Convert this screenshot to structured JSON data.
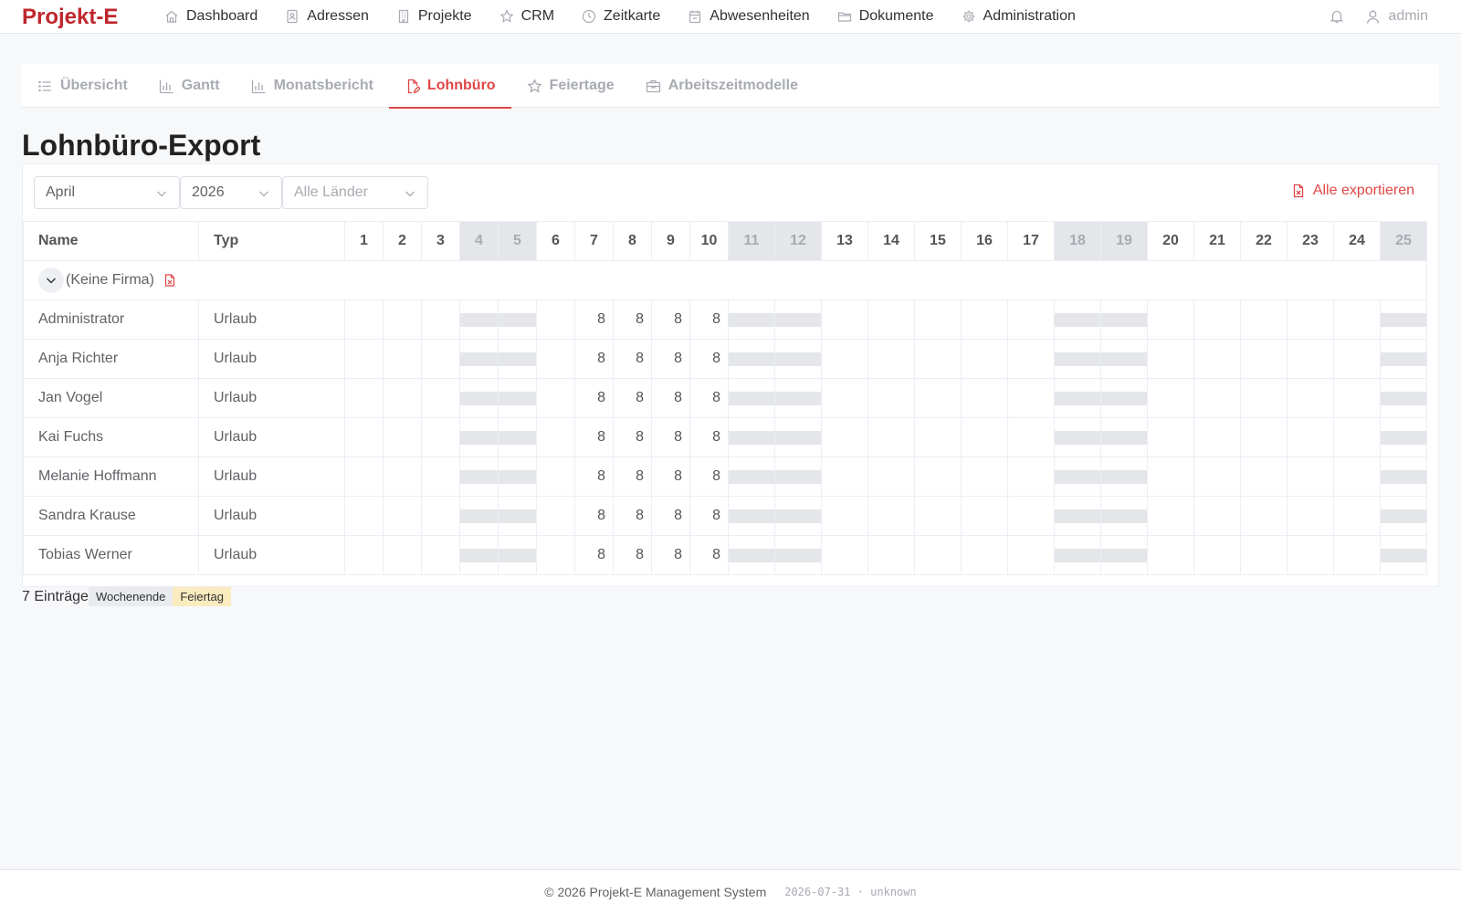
{
  "app": {
    "brand": "Projekt-E",
    "user": "admin"
  },
  "nav": {
    "items": [
      {
        "label": "Dashboard",
        "icon": "home-icon"
      },
      {
        "label": "Adressen",
        "icon": "address-book-icon"
      },
      {
        "label": "Projekte",
        "icon": "building-icon"
      },
      {
        "label": "CRM",
        "icon": "star-icon"
      },
      {
        "label": "Zeitkarte",
        "icon": "clock-icon"
      },
      {
        "label": "Abwesenheiten",
        "icon": "calendar-icon"
      },
      {
        "label": "Dokumente",
        "icon": "folder-icon"
      },
      {
        "label": "Administration",
        "icon": "gear-icon"
      }
    ]
  },
  "tabs": [
    {
      "label": "Übersicht",
      "icon": "list-icon",
      "active": false
    },
    {
      "label": "Gantt",
      "icon": "bar-chart-icon",
      "active": false
    },
    {
      "label": "Monatsbericht",
      "icon": "bar-chart-icon",
      "active": false
    },
    {
      "label": "Lohnbüro",
      "icon": "document-edit-icon",
      "active": true
    },
    {
      "label": "Feiertage",
      "icon": "star-icon",
      "active": false
    },
    {
      "label": "Arbeitszeitmodelle",
      "icon": "briefcase-icon",
      "active": false
    }
  ],
  "page": {
    "title": "Lohnbüro-Export"
  },
  "filters": {
    "month": "April",
    "year": "2026",
    "country_placeholder": "Alle Länder",
    "export_label": "Alle exportieren"
  },
  "table": {
    "col_name": "Name",
    "col_type": "Typ",
    "days": [
      1,
      2,
      3,
      4,
      5,
      6,
      7,
      8,
      9,
      10,
      11,
      12,
      13,
      14,
      15,
      16,
      17,
      18,
      19,
      20,
      21,
      22,
      23,
      24,
      25
    ],
    "weekend_days": [
      4,
      5,
      11,
      12,
      18,
      19,
      25
    ],
    "group_label": "(Keine Firma)",
    "rows": [
      {
        "name": "Administrator",
        "type": "Urlaub",
        "hours": {
          "7": 8,
          "8": 8,
          "9": 8,
          "10": 8
        }
      },
      {
        "name": "Anja Richter",
        "type": "Urlaub",
        "hours": {
          "7": 8,
          "8": 8,
          "9": 8,
          "10": 8
        }
      },
      {
        "name": "Jan Vogel",
        "type": "Urlaub",
        "hours": {
          "7": 8,
          "8": 8,
          "9": 8,
          "10": 8
        }
      },
      {
        "name": "Kai Fuchs",
        "type": "Urlaub",
        "hours": {
          "7": 8,
          "8": 8,
          "9": 8,
          "10": 8
        }
      },
      {
        "name": "Melanie Hoffmann",
        "type": "Urlaub",
        "hours": {
          "7": 8,
          "8": 8,
          "9": 8,
          "10": 8
        }
      },
      {
        "name": "Sandra Krause",
        "type": "Urlaub",
        "hours": {
          "7": 8,
          "8": 8,
          "9": 8,
          "10": 8
        }
      },
      {
        "name": "Tobias Werner",
        "type": "Urlaub",
        "hours": {
          "7": 8,
          "8": 8,
          "9": 8,
          "10": 8
        }
      }
    ]
  },
  "summary": {
    "count_text": "7 Einträge",
    "legend_weekend": "Wochenende",
    "legend_holiday": "Feiertag"
  },
  "footer": {
    "copyright": "© 2026 Projekt-E Management System",
    "build": "2026-07-31 · unknown"
  },
  "colors": {
    "brand": "#c0272d",
    "accent": "#e04646",
    "weekend": "#e4e6ea",
    "holiday": "#fbecc0"
  }
}
